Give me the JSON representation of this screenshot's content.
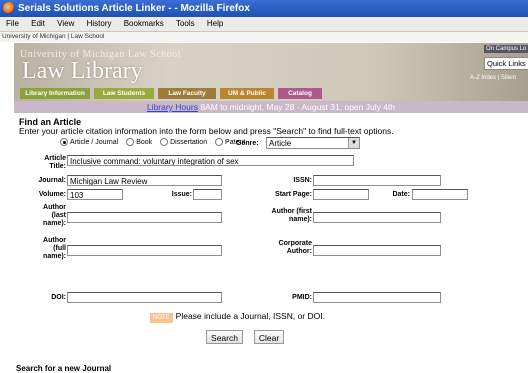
{
  "window": {
    "title": "Serials Solutions Article Linker - - Mozilla Firefox"
  },
  "menu": [
    "File",
    "Edit",
    "View",
    "History",
    "Bookmarks",
    "Tools",
    "Help"
  ],
  "breadcrumb": "University of Michigan | Law School",
  "banner": {
    "university": "University of Michigan Law School",
    "title": "Law Library",
    "tabs": [
      "Library Information",
      "Law Students",
      "Law Faculty",
      "UM & Public",
      "Catalog"
    ],
    "on_campus": "On Campus Lo",
    "quick_links": "Quick Links",
    "az_index": "A-Z Index | Sitem"
  },
  "hours": {
    "link": "Library Hours",
    "text": "8AM to midnight, May 28 - August 31, open July 4th"
  },
  "form": {
    "heading": "Find an Article",
    "intro": "Enter your article citation information into the form below and press \"Search\" to find full-text options.",
    "types": [
      {
        "label": "Article / Journal",
        "selected": true
      },
      {
        "label": "Book",
        "selected": false
      },
      {
        "label": "Dissertation",
        "selected": false
      },
      {
        "label": "Patent",
        "selected": false
      }
    ],
    "genre_label": "Genre:",
    "genre_value": "Article",
    "labels": {
      "article_title": "Article Title:",
      "journal": "Journal:",
      "issn": "ISSN:",
      "volume": "Volume:",
      "issue": "Issue:",
      "start_page": "Start Page:",
      "date": "Date:",
      "author_last": "Author (last name):",
      "author_first": "Author (first name):",
      "author_full": "Author (full name):",
      "corporate_author": "Corporate Author:",
      "doi": "DOI:",
      "pmid": "PMID:"
    },
    "values": {
      "article_title": "Inclusive command: voluntary integration of sex",
      "journal": "Michigan Law Review",
      "issn": "",
      "volume": "103",
      "issue": "",
      "start_page": "",
      "date": "",
      "author_last": "",
      "author_first": "",
      "author_full": "",
      "corporate_author": "",
      "doi": "",
      "pmid": ""
    },
    "note_tag": "NOTE",
    "note": "Please include a Journal, ISSN, or DOI.",
    "search": "Search",
    "clear": "Clear"
  },
  "search_journal": "Search for a new Journal"
}
